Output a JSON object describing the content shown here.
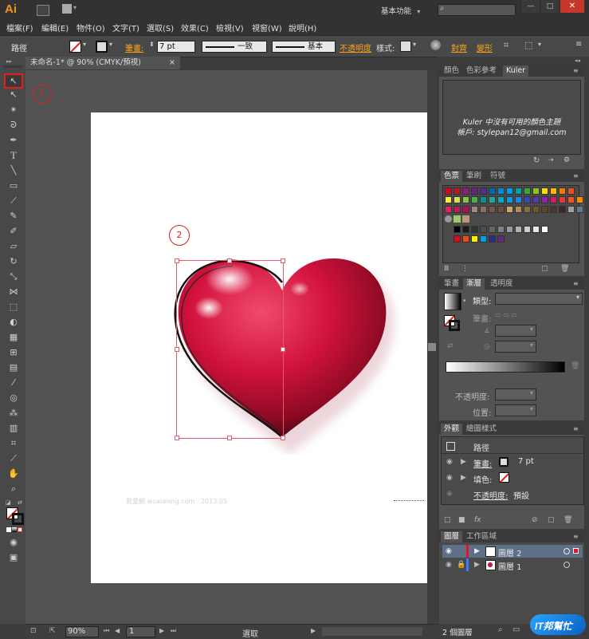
{
  "app": {
    "logo": "Ai"
  },
  "header": {
    "workspace": "基本功能",
    "workspace_arrow": "▾",
    "search_placeholder": "",
    "win_min": "—",
    "win_max": "□",
    "win_close": "✕"
  },
  "menus": [
    "檔案(F)",
    "編輯(E)",
    "物件(O)",
    "文字(T)",
    "選取(S)",
    "效果(C)",
    "檢視(V)",
    "視窗(W)",
    "說明(H)"
  ],
  "control": {
    "object_type": "路徑",
    "stroke_label": "筆畫:",
    "stroke_value": "7 pt",
    "profile_label": "一致",
    "brush_label": "基本",
    "opacity_label": "不透明度",
    "style_label": "樣式:",
    "align_label": "對齊",
    "transform_label": "變形"
  },
  "document": {
    "tab_title": "未命名-1* @ 90% (CMYK/預視)",
    "tab_close": "×"
  },
  "annotations": {
    "marker1": "1",
    "marker2": "2"
  },
  "watermark": {
    "text": "我愛網 woaiwang.com · 2013.05"
  },
  "kuler": {
    "tabs": [
      "顏色",
      "色彩參考",
      "Kuler"
    ],
    "message": "Kuler 中沒有可用的顏色主題",
    "account": "帳戶: stylepan12@gmail.com"
  },
  "swatches": {
    "tabs": [
      "色票",
      "筆刷",
      "符號"
    ],
    "row1": [
      "#ffffff",
      "#000000",
      "#e30613",
      "#ffed00",
      "#009640",
      "#009fe3",
      "#312783",
      "#e6007e",
      "#f39200",
      "#f7a600"
    ],
    "row1b": [
      "#e2001a",
      "#be1622",
      "#951b81",
      "#662483",
      "#5b2c87",
      "#0069b4",
      "#008bd2",
      "#009ee0",
      "#00a19a",
      "#3aaa35",
      "#95c11f",
      "#ffdd00",
      "#fbb900",
      "#ef7d00",
      "#e94e1b"
    ],
    "row2": [
      "#ffeb3b",
      "#d4e157",
      "#8bc34a",
      "#4caf50",
      "#009688",
      "#26a69a",
      "#00acc1",
      "#039be5",
      "#1e88e5",
      "#3949ab",
      "#5e35b1",
      "#8e24aa",
      "#d81b60",
      "#e53935",
      "#f4511e",
      "#fb8c00"
    ],
    "row3": [
      "#e91e63",
      "#c2185b",
      "#ad1457",
      "#a1887f",
      "#8d6e63",
      "#795548",
      "#6d4c41",
      "#c9a66b",
      "#b08d57",
      "#8a6d3b",
      "#6f5530",
      "#5d4527",
      "#4e342e",
      "#3e2723",
      "#9e9e9e",
      "#607d8b"
    ],
    "row5": [
      "#000000",
      "#1a1a1a",
      "#333333",
      "#4d4d4d",
      "#666666",
      "#808080",
      "#999999",
      "#b3b3b3",
      "#cccccc",
      "#e6e6e6",
      "#ffffff"
    ],
    "row6": [
      "#e30613",
      "#e94e1b",
      "#ffed00",
      "#009fe3",
      "#2d2e83",
      "#662483"
    ]
  },
  "stroke_panel": {
    "tabs": [
      "筆畫",
      "漸層",
      "透明度"
    ],
    "type_label": "類型:",
    "stroke_label": "筆畫:",
    "opacity_label": "不透明度:",
    "position_label": "位置:"
  },
  "appearance": {
    "tabs": [
      "外觀",
      "繪圖樣式"
    ],
    "title": "路徑",
    "stroke_label": "筆畫:",
    "stroke_value": "7 pt",
    "fill_label": "填色:",
    "opacity_label": "不透明度:",
    "opacity_value": "預設"
  },
  "layers": {
    "tabs": [
      "圖層",
      "工作區域"
    ],
    "items": [
      {
        "name": "圖層 2",
        "color": "#e8102a"
      },
      {
        "name": "圖層 1",
        "color": "#3a7bff"
      }
    ],
    "count": "2 個圖層"
  },
  "status": {
    "zoom": "90%",
    "page": "1",
    "mode": "選取"
  },
  "logo": {
    "text": "IT邦幫忙"
  }
}
